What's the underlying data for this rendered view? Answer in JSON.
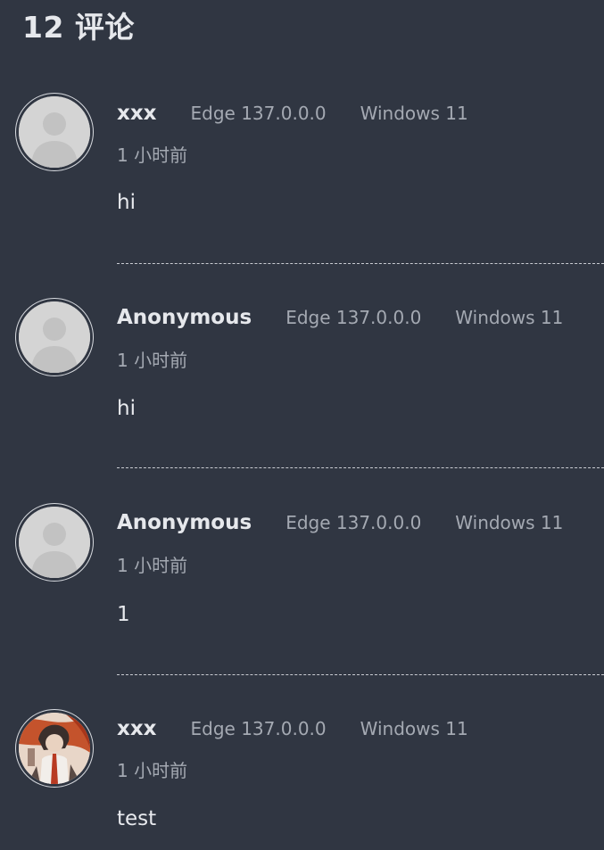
{
  "header": {
    "title": "12 评论"
  },
  "comments": [
    {
      "author": "xxx",
      "browser": "Edge 137.0.0.0",
      "os": "Windows 11",
      "time": "1 小时前",
      "text": "hi",
      "avatar": "default-avatar-icon"
    },
    {
      "author": "Anonymous",
      "browser": "Edge 137.0.0.0",
      "os": "Windows 11",
      "time": "1 小时前",
      "text": "hi",
      "avatar": "default-avatar-icon"
    },
    {
      "author": "Anonymous",
      "browser": "Edge 137.0.0.0",
      "os": "Windows 11",
      "time": "1 小时前",
      "text": "1",
      "avatar": "default-avatar-icon"
    },
    {
      "author": "xxx",
      "browser": "Edge 137.0.0.0",
      "os": "Windows 11",
      "time": "1 小时前",
      "text": "test",
      "avatar": "user-photo-avatar"
    }
  ],
  "colors": {
    "background": "#303642",
    "muted_text": "#a4a9b2",
    "primary_text": "#e6e8ec"
  }
}
